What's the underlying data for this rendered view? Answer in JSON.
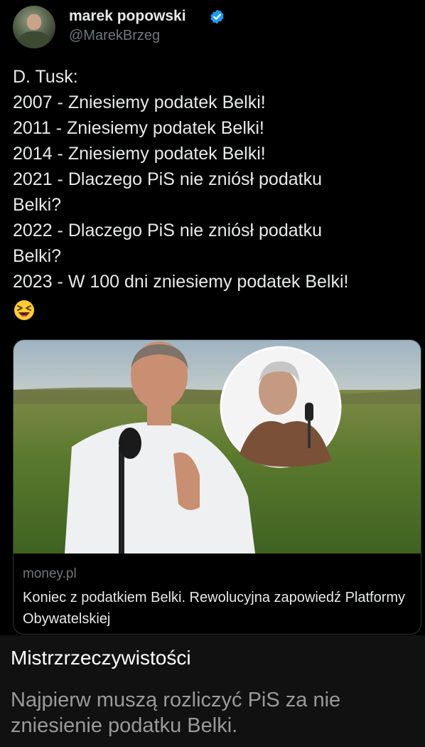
{
  "tweet": {
    "name": "marek popowski",
    "handle": "@MarekBrzeg",
    "lines": [
      "D. Tusk:",
      "2007 - Zniesiemy podatek Belki!",
      "2011 - Zniesiemy podatek Belki!",
      "2014 - Zniesiemy podatek Belki!",
      "2021 - Dlaczego PiS nie zniósł podatku",
      "Belki?",
      "2022 - Dlaczego PiS nie zniósł podatku",
      "Belki?",
      "2023 - W 100 dni zniesiemy podatek Belki!"
    ],
    "emoji": "laughing-face-emoji"
  },
  "card": {
    "domain": "money.pl",
    "title": "Koniec z podatkiem Belki. Rewolucyjna zapowiedź Platformy Obywatelskiej"
  },
  "comment": {
    "user": "Mistrzrzeczywistości",
    "text": "Najpierw muszą rozliczyć PiS za nie zniesienie podatku Belki."
  },
  "colors": {
    "background": "#000000",
    "verified": "#1d9bf0",
    "secondary_text": "#71767b",
    "comment_bg": "#111111"
  }
}
